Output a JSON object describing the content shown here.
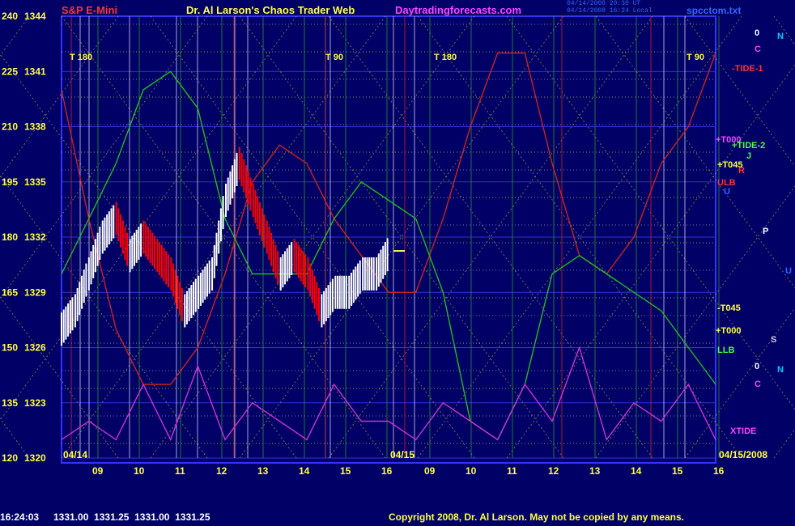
{
  "header": {
    "symbol": "S&P E-Mini",
    "title": "Dr. Al Larson's Chaos Trader Web",
    "site": "Daytradingforecasts.com",
    "file": "spcctom.txt",
    "timestamp_line1": "04/14/2008 20:30 UT",
    "timestamp_line2": "04/14/2008 16:24 Local"
  },
  "status": {
    "time": "16:24:03",
    "ohlc": "1331.00  1331.25  1331.00  1331.25",
    "copyright": "Copyright 2008, Dr. Al Larson. May not be copied by any means."
  },
  "dates": {
    "left": "04/14",
    "mid": "04/15",
    "right": "04/15/2008"
  },
  "colors": {
    "background": "#000066",
    "frame": "#3333ff",
    "price_up": "#ffffff",
    "price_down": "#ff0000",
    "tide1": "#cc2222",
    "tide2": "#22bb22",
    "xtide": "#cc33cc",
    "title": "#ffff44",
    "site": "#ff44ff",
    "symbol": "#ff3333"
  },
  "chart_data": {
    "type": "line",
    "y_left_ticks": [
      "240",
      "225",
      "210",
      "195",
      "180",
      "165",
      "150",
      "135",
      "120"
    ],
    "y_price_ticks": [
      "1344",
      "1341",
      "1338",
      "1335",
      "1332",
      "1329",
      "1326",
      "1323",
      "1320"
    ],
    "y_range": [
      1320,
      1344
    ],
    "x_ticks": [
      "09",
      "10",
      "11",
      "12",
      "13",
      "14",
      "15",
      "16",
      "09",
      "10",
      "11",
      "12",
      "13",
      "14",
      "15",
      "16"
    ],
    "right_labels": [
      {
        "text": "0",
        "color": "#ffffff"
      },
      {
        "text": "N",
        "color": "#00ccff"
      },
      {
        "text": "C",
        "color": "#ff44ff"
      },
      {
        "text": "-TIDE-1",
        "color": "#ff3333"
      },
      {
        "text": "+T000",
        "color": "#ff44ff"
      },
      {
        "text": "+TIDE-2",
        "color": "#44ff44"
      },
      {
        "text": "J",
        "color": "#44ff44"
      },
      {
        "text": "+T045",
        "color": "#ffff44"
      },
      {
        "text": "R",
        "color": "#ff3333"
      },
      {
        "text": "ULB",
        "color": "#ff3333"
      },
      {
        "text": "U",
        "color": "#3366ff"
      },
      {
        "text": "P",
        "color": "#ffffff"
      },
      {
        "text": "U",
        "color": "#3366ff"
      },
      {
        "text": "-T045",
        "color": "#ffff44"
      },
      {
        "text": "+T000",
        "color": "#ffff44"
      },
      {
        "text": "S",
        "color": "#cccccc"
      },
      {
        "text": "LLB",
        "color": "#44ff44"
      },
      {
        "text": "0",
        "color": "#ffffff"
      },
      {
        "text": "N",
        "color": "#00ccff"
      },
      {
        "text": "C",
        "color": "#ff44ff"
      },
      {
        "text": "XTIDE",
        "color": "#ff44ff"
      }
    ],
    "t_labels": [
      "T 180",
      "T 90",
      "T 180",
      "T 90"
    ],
    "series": [
      {
        "name": "-TIDE-1",
        "values": [
          1340,
          1333,
          1327,
          1324,
          1324,
          1326,
          1330,
          1335,
          1337,
          1336,
          1333,
          1331,
          1329,
          1329,
          1333,
          1338,
          1342,
          1342,
          1336,
          1331,
          1330,
          1332,
          1336,
          1338,
          1342
        ]
      },
      {
        "name": "+TIDE-2",
        "values": [
          1330,
          1333,
          1336,
          1340,
          1341,
          1339,
          1333,
          1330,
          1330,
          1330,
          1333,
          1335,
          1334,
          1333,
          1329,
          1322,
          1321,
          1324,
          1330,
          1331,
          1330,
          1329,
          1328,
          1326,
          1324
        ]
      },
      {
        "name": "XTIDE",
        "values": [
          1321,
          1322,
          1321,
          1324,
          1321,
          1325,
          1321,
          1323,
          1322,
          1321,
          1324,
          1322,
          1322,
          1321,
          1323,
          1322,
          1321,
          1324,
          1322,
          1326,
          1321,
          1323,
          1322,
          1324,
          1321
        ]
      },
      {
        "name": "Price",
        "values": [
          1327,
          1328,
          1330,
          1332,
          1333,
          1331,
          1332,
          1331,
          1330,
          1328,
          1329,
          1330,
          1334,
          1336,
          1334,
          1332,
          1330,
          1331,
          1330,
          1328,
          1329,
          1329,
          1330,
          1330,
          1331.25
        ]
      }
    ]
  }
}
